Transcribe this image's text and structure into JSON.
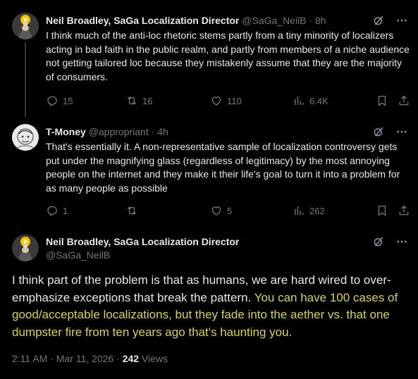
{
  "tweet1": {
    "name": "Neil Broadley, SaGa Localization Director",
    "handle": "@SaGa_NeilB",
    "sep": "·",
    "time": "8h",
    "text": "I think much of the anti-loc rhetoric stems partly from a tiny minority of localizers acting in bad faith in the public realm, and partly from members of a niche audience not getting tailored loc because they mistakenly assume that they are the majority of consumers.",
    "replies": "15",
    "reposts": "16",
    "likes": "110",
    "views": "6.4K"
  },
  "tweet2": {
    "name": "T-Money",
    "handle": "@appropriant",
    "sep": "·",
    "time": "4h",
    "text": "That's essentially it. A non-representative sample of localization controversy gets put under the magnifying glass (regardless of legitimacy) by the most annoying people on the internet and they make it their life's goal to turn it into a problem for as many people as possible",
    "replies": "1",
    "reposts": "",
    "likes": "5",
    "views": "262"
  },
  "main": {
    "name": "Neil Broadley, SaGa Localization Director",
    "handle": "@SaGa_NeilB",
    "text_plain": "I think part of the problem is that as humans, we are hard wired to over-emphasize exceptions that break the pattern. ",
    "text_highlight": "You can have 100 cases of good/acceptable localizations, but they fade into the aether vs. that one dumpster fire from ten years ago that's haunting you.",
    "timestamp": "2:11 AM · Mar 11, 2026 · ",
    "views_count": "242",
    "views_label": "Views"
  },
  "icons": {
    "more": "more-icon",
    "grok": "grok-icon",
    "reply": "reply-icon",
    "repost": "repost-icon",
    "like": "like-icon",
    "views": "views-icon",
    "bookmark": "bookmark-icon",
    "share": "share-icon"
  },
  "colors": {
    "background": "#000000",
    "text": "#e7e9ea",
    "muted": "#71767b",
    "highlight": "#d6d35f"
  }
}
